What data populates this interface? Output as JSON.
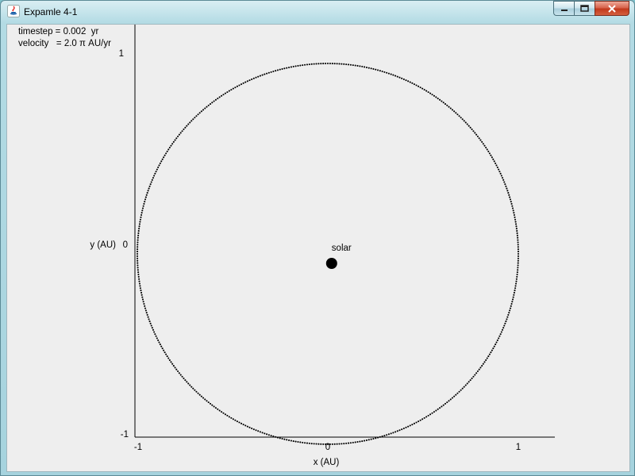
{
  "window": {
    "title": "Expamle 4-1",
    "controls": {
      "minimize": "minimize",
      "maximize": "maximize",
      "close": "close"
    }
  },
  "info": {
    "timestep": "timestep = 0.002  yr",
    "velocity": "velocity   = 2.0 π AU/yr"
  },
  "chart_data": {
    "type": "scatter",
    "xlabel": "x (AU)",
    "ylabel": "y (AU)",
    "xlim": [
      -1,
      1.2
    ],
    "ylim": [
      -1,
      1
    ],
    "x_ticks": [
      "-1",
      "0",
      "1"
    ],
    "y_ticks": [
      "1",
      "0",
      "-1"
    ],
    "orbit": {
      "shape": "circle",
      "center": [
        0,
        0
      ],
      "radius": 1.0,
      "marker_color": "#000000"
    },
    "points": [
      {
        "x": 0.02,
        "y": -0.05,
        "label": "solar",
        "marker_color": "#000000"
      }
    ]
  }
}
